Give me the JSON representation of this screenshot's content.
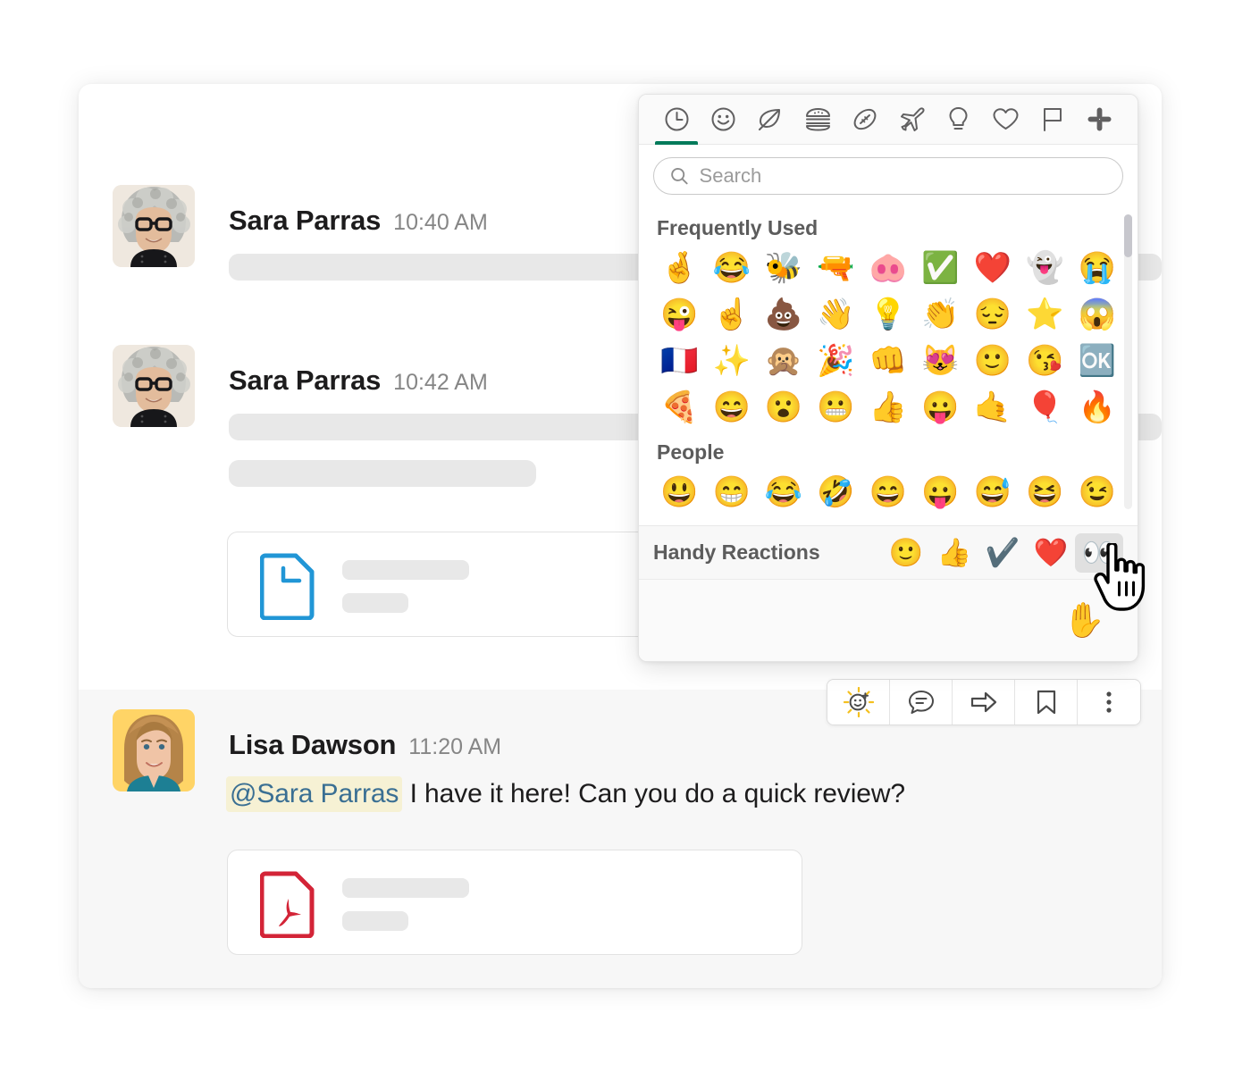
{
  "app": {
    "name": "slack-message-emoji-picker"
  },
  "messages": [
    {
      "author": "Sara Parras",
      "time": "10:40 AM",
      "avatar": "sara-parras-avatar",
      "body_placeholder": true
    },
    {
      "author": "Sara Parras",
      "time": "10:42 AM",
      "avatar": "sara-parras-avatar",
      "body_placeholder": true,
      "attachment": {
        "type": "document",
        "icon": "blue-document-icon",
        "color": "#2196d6"
      }
    },
    {
      "author": "Lisa Dawson",
      "time": "11:20 AM",
      "avatar": "lisa-dawson-avatar",
      "mention": "@Sara Parras",
      "text": " I have it here! Can you do a quick review?",
      "attachment": {
        "type": "pdf",
        "icon": "pdf-document-icon",
        "color": "#d32437"
      }
    }
  ],
  "action_bar": {
    "buttons": [
      {
        "name": "add-reaction-button",
        "icon": "emoji-plus-sparkle-icon"
      },
      {
        "name": "reply-in-thread-button",
        "icon": "speech-bubble-icon"
      },
      {
        "name": "forward-message-button",
        "icon": "arrow-right-icon"
      },
      {
        "name": "save-message-button",
        "icon": "bookmark-icon"
      },
      {
        "name": "more-actions-button",
        "icon": "vertical-ellipsis-icon"
      }
    ]
  },
  "picker": {
    "tabs": [
      {
        "name": "frequently-used",
        "icon": "clock-icon",
        "active": true
      },
      {
        "name": "smileys-people",
        "icon": "smiley-icon",
        "active": false
      },
      {
        "name": "nature",
        "icon": "leaf-icon",
        "active": false
      },
      {
        "name": "food-drink",
        "icon": "burger-icon",
        "active": false
      },
      {
        "name": "activity",
        "icon": "football-icon",
        "active": false
      },
      {
        "name": "travel-places",
        "icon": "airplane-icon",
        "active": false
      },
      {
        "name": "objects",
        "icon": "lightbulb-icon",
        "active": false
      },
      {
        "name": "symbols",
        "icon": "heart-outline-icon",
        "active": false
      },
      {
        "name": "flags",
        "icon": "flag-icon",
        "active": false
      },
      {
        "name": "custom-slack",
        "icon": "slack-logo-icon",
        "active": false
      }
    ],
    "search": {
      "value": "",
      "placeholder": "Search",
      "icon": "search-icon"
    },
    "sections": [
      {
        "title": "Frequently Used",
        "emojis": [
          "🤞",
          "😂",
          "🐝",
          "🔫",
          "🐽",
          "✅",
          "❤️",
          "👻",
          "😭",
          "😜",
          "☝️",
          "💩",
          "👋",
          "💡",
          "👏",
          "😔",
          "⭐",
          "😱",
          "🇫🇷",
          "✨",
          "🙊",
          "🎉",
          "👊",
          "😻",
          "🙂",
          "😘",
          "🆗",
          "🍕",
          "😄",
          "😮",
          "😬",
          "👍",
          "😛",
          "🤙",
          "🎈",
          "🔥"
        ]
      },
      {
        "title": "People",
        "emojis": [
          "😃",
          "😁",
          "😂",
          "🤣",
          "😄",
          "😛",
          "😅",
          "😆",
          "😉"
        ]
      }
    ],
    "handy_reactions": {
      "label": "Handy Reactions",
      "emojis": [
        {
          "glyph": "🙂",
          "name": "slightly-smiling-face",
          "selected": false
        },
        {
          "glyph": "👍",
          "name": "thumbs-up",
          "selected": false
        },
        {
          "glyph": "✔️",
          "name": "heavy-check-mark",
          "selected": false
        },
        {
          "glyph": "❤️",
          "name": "red-heart",
          "selected": false
        },
        {
          "glyph": "👀",
          "name": "eyes",
          "selected": true
        }
      ]
    },
    "footer": {
      "preview_emoji": "✋",
      "preview_name": "raised-hand"
    }
  },
  "colors": {
    "accent_green": "#007a5a",
    "mention_text": "#3a6f93",
    "mention_bg": "#f6f1d4",
    "doc_blue": "#2196d6",
    "pdf_red": "#d32437"
  }
}
